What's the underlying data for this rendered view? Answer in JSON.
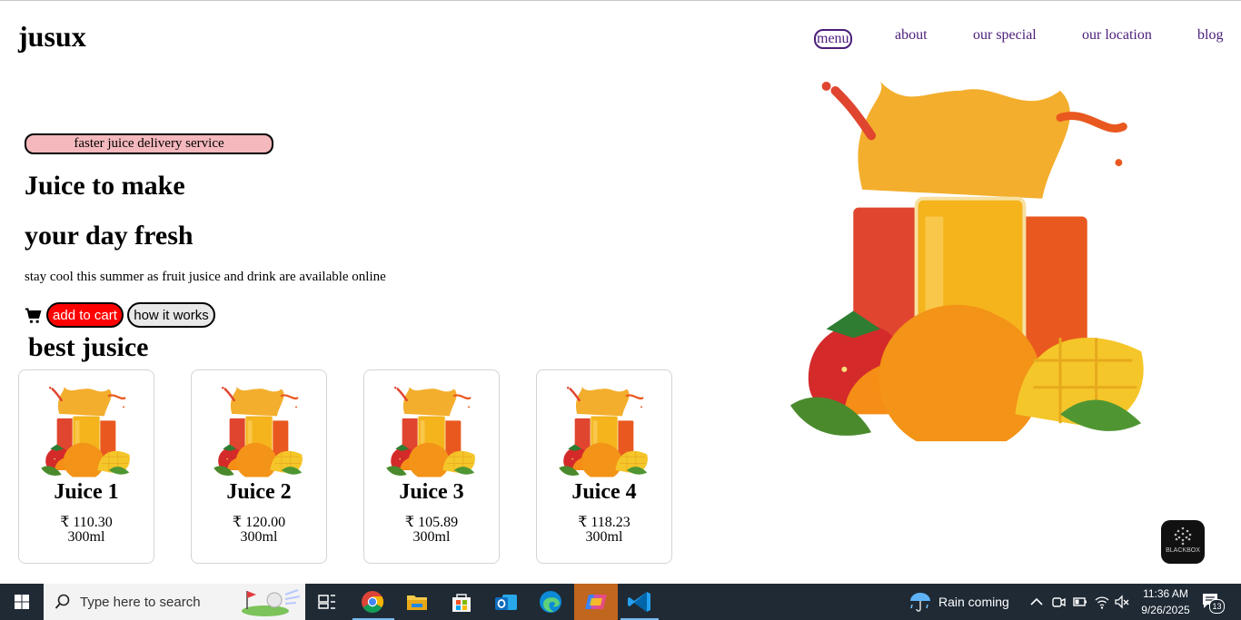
{
  "brand": {
    "logo": "jusux"
  },
  "nav": {
    "items": [
      {
        "label": "menu",
        "active": true
      },
      {
        "label": "about"
      },
      {
        "label": "our special"
      },
      {
        "label": "our location"
      },
      {
        "label": "blog"
      }
    ]
  },
  "hero": {
    "badge": "faster juice delivery service",
    "title_line1": "Juice to make",
    "title_line2": "your day fresh",
    "description": "stay cool this summer as fruit jusice and drink are available online",
    "cart_icon": "shopping-cart-icon",
    "add_to_cart": "add to cart",
    "how_it_works": "how it works"
  },
  "section": {
    "title": "best jusice"
  },
  "products": [
    {
      "name": "Juice 1",
      "price": "₹ 110.30",
      "volume": "300ml"
    },
    {
      "name": "Juice 2",
      "price": "₹ 120.00",
      "volume": "300ml"
    },
    {
      "name": "Juice 3",
      "price": "₹ 105.89",
      "volume": "300ml"
    },
    {
      "name": "Juice 4",
      "price": "₹ 118.23",
      "volume": "300ml"
    }
  ],
  "floating_app": {
    "label": "BLACKBOX"
  },
  "colors": {
    "nav_link": "#4a1d7a",
    "badge_bg": "#f4b8bd",
    "cart_button": "#ff0000",
    "taskbar": "#1f2a35"
  },
  "taskbar": {
    "search_placeholder": "Type here to search",
    "weather": "Rain coming",
    "time": "11:36 AM",
    "date": "9/26/2025",
    "notification_count": "13"
  }
}
